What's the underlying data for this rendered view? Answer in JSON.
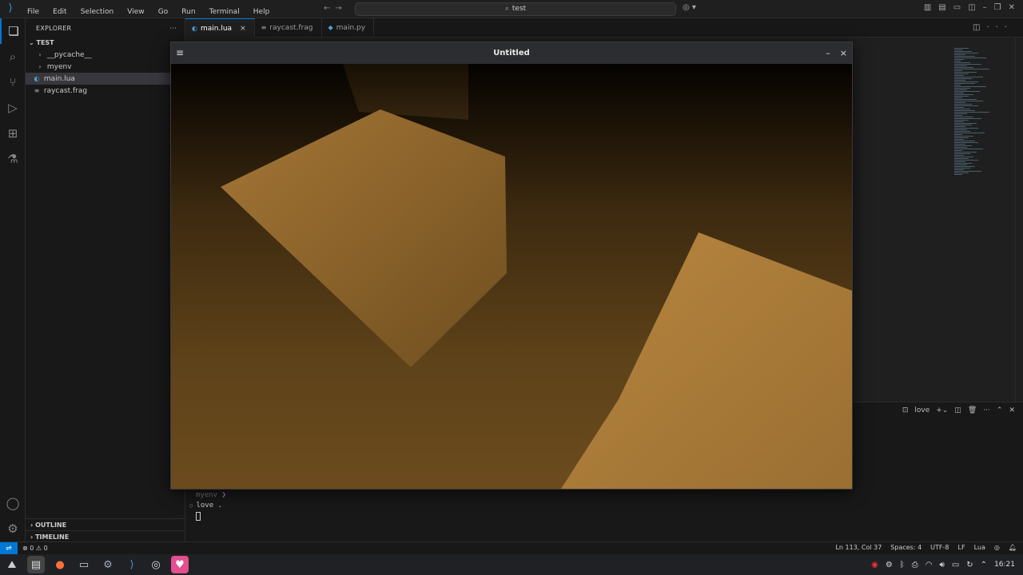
{
  "titlebar": {
    "menu": [
      "File",
      "Edit",
      "Selection",
      "View",
      "Go",
      "Run",
      "Terminal",
      "Help"
    ],
    "search": "test"
  },
  "explorer": {
    "title": "EXPLORER",
    "more": "···",
    "root": "TEST",
    "items": [
      {
        "label": "__pycache__",
        "kind": "folder"
      },
      {
        "label": "myenv",
        "kind": "folder"
      },
      {
        "label": "main.lua",
        "kind": "lua",
        "selected": true
      },
      {
        "label": "raycast.frag",
        "kind": "frag"
      }
    ],
    "outline": "OUTLINE",
    "timeline": "TIMELINE"
  },
  "tabs": [
    {
      "label": "main.lua",
      "active": true,
      "close": "×"
    },
    {
      "label": "raycast.frag",
      "active": false
    },
    {
      "label": "main.py",
      "active": false
    }
  ],
  "love_window": {
    "title": "Untitled",
    "menu_icon": "hamburger-icon",
    "minimize": "–",
    "close": "×"
  },
  "terminal": {
    "tab_label": "love",
    "prompt": "myenv",
    "chevron": "❯",
    "command": "love ."
  },
  "statusbar": {
    "errors": "0",
    "warnings": "0",
    "position": "Ln 113, Col 37",
    "spaces": "Spaces: 4",
    "encoding": "UTF-8",
    "eol": "LF",
    "language": "Lua"
  },
  "taskbar": {
    "clock": "16:21"
  },
  "colors": {
    "accent": "#0078d4",
    "scene_floor": "#6a4a1e",
    "scene_cube": "#b58540"
  }
}
